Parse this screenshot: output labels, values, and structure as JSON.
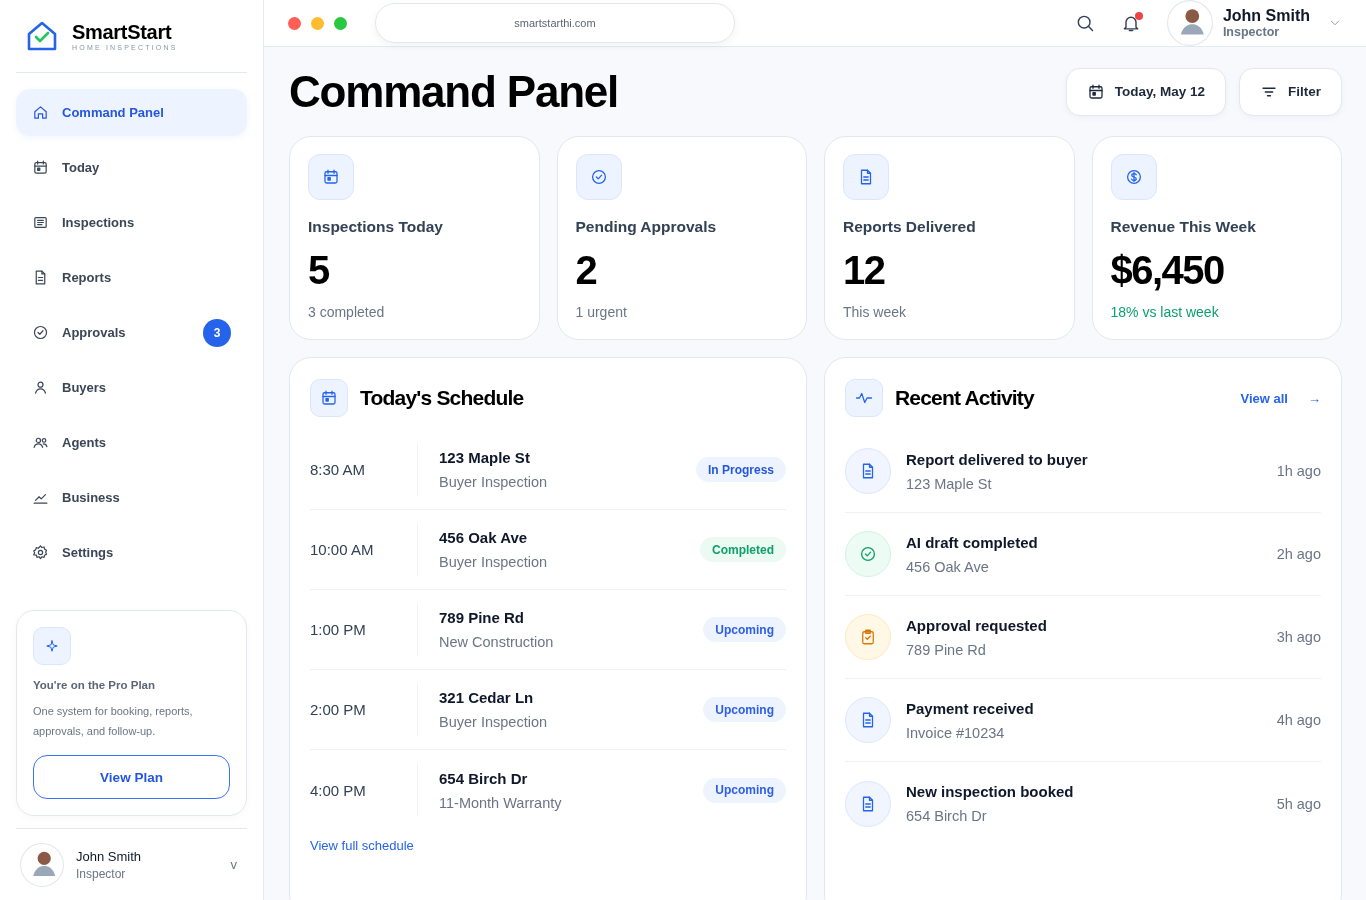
{
  "brand": {
    "name": "SmartStart",
    "tagline": "HOME INSPECTIONS"
  },
  "sidebar": {
    "items": [
      {
        "label": "Command Panel",
        "kind": "home",
        "selected": true
      },
      {
        "label": "Today",
        "kind": "calendar",
        "selected": false
      },
      {
        "label": "Inspections",
        "kind": "list",
        "selected": false
      },
      {
        "label": "Reports",
        "kind": "document",
        "selected": false
      },
      {
        "label": "Approvals",
        "kind": "check",
        "selected": false,
        "badge": "3"
      },
      {
        "label": "Buyers",
        "kind": "user",
        "selected": false
      },
      {
        "label": "Agents",
        "kind": "users",
        "selected": false
      },
      {
        "label": "Business",
        "kind": "chart",
        "selected": false
      },
      {
        "label": "Settings",
        "kind": "gear",
        "selected": false
      }
    ],
    "plan_card": {
      "title": "You're on the Pro Plan",
      "text": "One system for booking, reports, approvals, and follow-up.",
      "button": "View Plan"
    },
    "user": {
      "name": "John Smith",
      "role": "Inspector",
      "caret": "v"
    }
  },
  "topbar": {
    "address": "smartstarthi.com",
    "notifications_unread": true,
    "user": {
      "name": "John Smith",
      "role": "Inspector"
    }
  },
  "header": {
    "title": "Command Panel",
    "date_button": "Today, May 12",
    "filter_button": "Filter"
  },
  "stats": [
    {
      "kind": "calendar",
      "label": "Inspections Today",
      "value": "5",
      "note": "3 completed",
      "positive": false
    },
    {
      "kind": "check",
      "label": "Pending Approvals",
      "value": "2",
      "note": "1 urgent",
      "positive": false
    },
    {
      "kind": "document",
      "label": "Reports Delivered",
      "value": "12",
      "note": "This week",
      "positive": false
    },
    {
      "kind": "dollar",
      "label": "Revenue This Week",
      "value": "$6,450",
      "note": "18% vs last week",
      "positive": true
    }
  ],
  "schedule": {
    "title": "Today's Schedule",
    "rows": [
      {
        "time": "8:30 AM",
        "address": "123 Maple St",
        "type": "Buyer Inspection",
        "status": "In Progress",
        "kind": "in_progress"
      },
      {
        "time": "10:00 AM",
        "address": "456 Oak Ave",
        "type": "Buyer Inspection",
        "status": "Completed",
        "kind": "completed"
      },
      {
        "time": "1:00 PM",
        "address": "789 Pine Rd",
        "type": "New Construction",
        "status": "Upcoming",
        "kind": "upcoming"
      },
      {
        "time": "2:00 PM",
        "address": "321 Cedar Ln",
        "type": "Buyer Inspection",
        "status": "Upcoming",
        "kind": "upcoming"
      },
      {
        "time": "4:00 PM",
        "address": "654 Birch Dr",
        "type": "11-Month Warranty",
        "status": "Upcoming",
        "kind": "upcoming"
      }
    ],
    "link": "View full schedule"
  },
  "activity": {
    "title": "Recent Activity",
    "link": "View all",
    "link_arrow": "→",
    "items": [
      {
        "kind": "document",
        "title": "Report delivered to buyer",
        "detail": "123 Maple St",
        "time": "1h ago"
      },
      {
        "kind": "check",
        "title": "AI draft completed",
        "detail": "456 Oak Ave",
        "time": "2h ago"
      },
      {
        "kind": "clipboard",
        "title": "Approval requested",
        "detail": "789 Pine Rd",
        "time": "3h ago"
      },
      {
        "kind": "document",
        "title": "Payment received",
        "detail": "Invoice #10234",
        "time": "4h ago"
      },
      {
        "kind": "document",
        "title": "New inspection booked",
        "detail": "654 Birch Dr",
        "time": "5h ago"
      }
    ]
  }
}
